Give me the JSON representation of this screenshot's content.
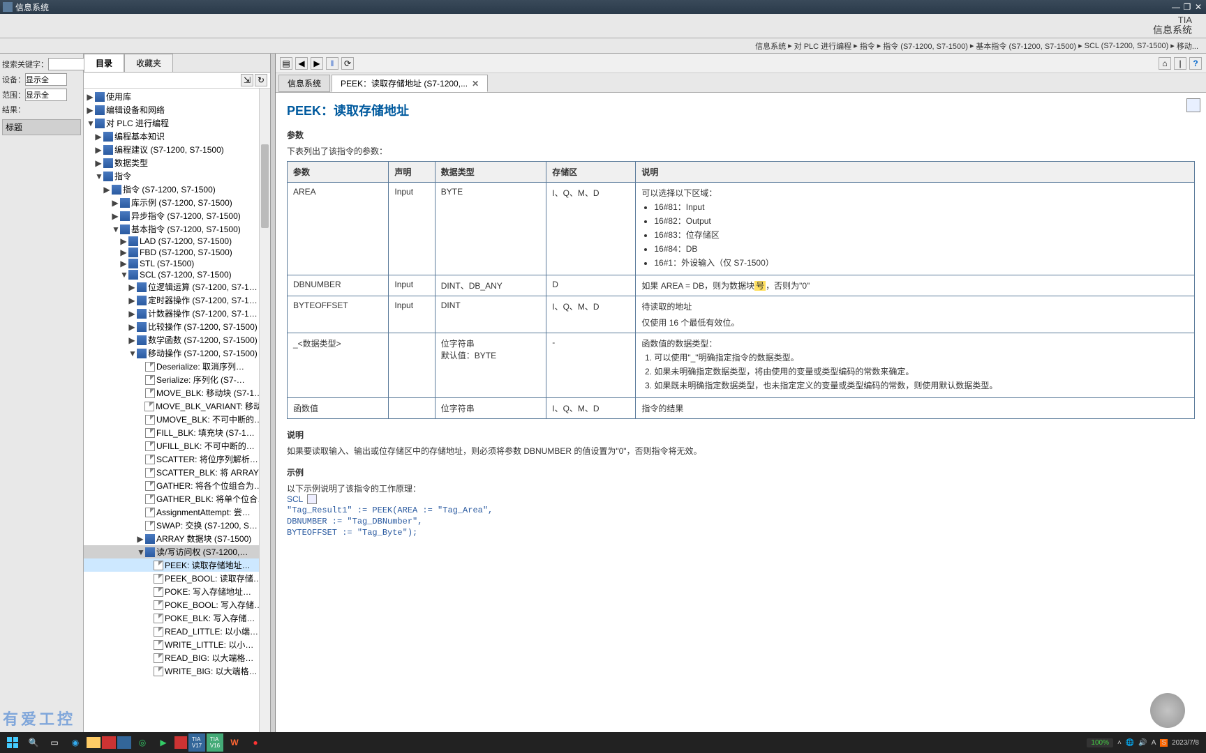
{
  "window": {
    "title": "信息系统"
  },
  "brand": {
    "top": "TIA",
    "bottom": "信息系统"
  },
  "breadcrumb": [
    "信息系统",
    "对 PLC 进行编程",
    "指令",
    "指令 (S7-1200, S7-1500)",
    "基本指令 (S7-1200, S7-1500)",
    "SCL (S7-1200, S7-1500)",
    "移动..."
  ],
  "search": {
    "kw_label": "搜索关键字：",
    "device_label": "设备：",
    "device_value": "显示全",
    "range_label": "范围：",
    "range_value": "显示全",
    "result_label": "结果：",
    "column": "标题"
  },
  "tabs": {
    "toc": "目录",
    "fav": "收藏夹"
  },
  "tree": [
    {
      "ind": 0,
      "exp": "▶",
      "icn": "book",
      "label": "使用库"
    },
    {
      "ind": 0,
      "exp": "▶",
      "icn": "book",
      "label": "编辑设备和网络"
    },
    {
      "ind": 0,
      "exp": "▼",
      "icn": "book",
      "label": "对 PLC 进行编程"
    },
    {
      "ind": 1,
      "exp": "▶",
      "icn": "book",
      "label": "编程基本知识"
    },
    {
      "ind": 1,
      "exp": "▶",
      "icn": "book",
      "label": "编程建议 (S7-1200, S7-1500)"
    },
    {
      "ind": 1,
      "exp": "▶",
      "icn": "book",
      "label": "数据类型"
    },
    {
      "ind": 1,
      "exp": "▼",
      "icn": "book",
      "label": "指令"
    },
    {
      "ind": 2,
      "exp": "▶",
      "icn": "book",
      "label": "指令 (S7-1200, S7-1500)"
    },
    {
      "ind": 3,
      "exp": "▶",
      "icn": "book",
      "label": "库示例 (S7-1200, S7-1500)"
    },
    {
      "ind": 3,
      "exp": "▶",
      "icn": "book",
      "label": "异步指令 (S7-1200, S7-1500)"
    },
    {
      "ind": 3,
      "exp": "▼",
      "icn": "book",
      "label": "基本指令 (S7-1200, S7-1500)"
    },
    {
      "ind": 4,
      "exp": "▶",
      "icn": "book",
      "label": "LAD (S7-1200, S7-1500)"
    },
    {
      "ind": 4,
      "exp": "▶",
      "icn": "book",
      "label": "FBD (S7-1200, S7-1500)"
    },
    {
      "ind": 4,
      "exp": "▶",
      "icn": "book",
      "label": "STL (S7-1500)"
    },
    {
      "ind": 4,
      "exp": "▼",
      "icn": "book",
      "label": "SCL (S7-1200, S7-1500)"
    },
    {
      "ind": 5,
      "exp": "▶",
      "icn": "book",
      "label": "位逻辑运算 (S7-1200, S7-1…"
    },
    {
      "ind": 5,
      "exp": "▶",
      "icn": "book",
      "label": "定时器操作 (S7-1200, S7-1…"
    },
    {
      "ind": 5,
      "exp": "▶",
      "icn": "book",
      "label": "计数器操作 (S7-1200, S7-1…"
    },
    {
      "ind": 5,
      "exp": "▶",
      "icn": "book",
      "label": "比较操作 (S7-1200, S7-1500)"
    },
    {
      "ind": 5,
      "exp": "▶",
      "icn": "book",
      "label": "数学函数 (S7-1200, S7-1500)"
    },
    {
      "ind": 5,
      "exp": "▼",
      "icn": "book",
      "label": "移动操作 (S7-1200, S7-1500)"
    },
    {
      "ind": 6,
      "exp": "",
      "icn": "doc",
      "label": "Deserialize: 取消序列…"
    },
    {
      "ind": 6,
      "exp": "",
      "icn": "doc",
      "label": "Serialize: 序列化 (S7-…"
    },
    {
      "ind": 6,
      "exp": "",
      "icn": "doc",
      "label": "MOVE_BLK: 移动块 (S7-1…"
    },
    {
      "ind": 6,
      "exp": "",
      "icn": "doc",
      "label": "MOVE_BLK_VARIANT: 移动…"
    },
    {
      "ind": 6,
      "exp": "",
      "icn": "doc",
      "label": "UMOVE_BLK: 不可中断的…"
    },
    {
      "ind": 6,
      "exp": "",
      "icn": "doc",
      "label": "FILL_BLK: 填充块 (S7-1…"
    },
    {
      "ind": 6,
      "exp": "",
      "icn": "doc",
      "label": "UFILL_BLK: 不可中断的…"
    },
    {
      "ind": 6,
      "exp": "",
      "icn": "doc",
      "label": "SCATTER: 将位序列解析…"
    },
    {
      "ind": 6,
      "exp": "",
      "icn": "doc",
      "label": "SCATTER_BLK: 将 ARRAY …"
    },
    {
      "ind": 6,
      "exp": "",
      "icn": "doc",
      "label": "GATHER: 将各个位组合为…"
    },
    {
      "ind": 6,
      "exp": "",
      "icn": "doc",
      "label": "GATHER_BLK: 将单个位合…"
    },
    {
      "ind": 6,
      "exp": "",
      "icn": "doc",
      "label": "AssignmentAttempt: 尝…"
    },
    {
      "ind": 6,
      "exp": "",
      "icn": "doc",
      "label": "SWAP: 交换 (S7-1200, S…"
    },
    {
      "ind": 6,
      "exp": "▶",
      "icn": "book",
      "label": "ARRAY 数据块 (S7-1500)"
    },
    {
      "ind": 6,
      "exp": "▼",
      "icn": "book",
      "label": "读/写访问权 (S7-1200,…",
      "sel2": true
    },
    {
      "ind": 7,
      "exp": "",
      "icn": "doc",
      "label": "PEEK: 读取存储地址…",
      "sel": true
    },
    {
      "ind": 7,
      "exp": "",
      "icn": "doc",
      "label": "PEEK_BOOL: 读取存储…"
    },
    {
      "ind": 7,
      "exp": "",
      "icn": "doc",
      "label": "POKE: 写入存储地址…"
    },
    {
      "ind": 7,
      "exp": "",
      "icn": "doc",
      "label": "POKE_BOOL: 写入存储…"
    },
    {
      "ind": 7,
      "exp": "",
      "icn": "doc",
      "label": "POKE_BLK: 写入存储…"
    },
    {
      "ind": 7,
      "exp": "",
      "icn": "doc",
      "label": "READ_LITTLE: 以小端…"
    },
    {
      "ind": 7,
      "exp": "",
      "icn": "doc",
      "label": "WRITE_LITTLE: 以小…"
    },
    {
      "ind": 7,
      "exp": "",
      "icn": "doc",
      "label": "READ_BIG: 以大端格…"
    },
    {
      "ind": 7,
      "exp": "",
      "icn": "doc",
      "label": "WRITE_BIG: 以大端格…"
    }
  ],
  "mtabs": [
    {
      "label": "信息系统",
      "active": false
    },
    {
      "label": "PEEK：读取存储地址 (S7-1200,...",
      "active": true
    }
  ],
  "page": {
    "title": "PEEK：读取存储地址",
    "sec_params": "参数",
    "params_intro": "下表列出了该指令的参数：",
    "th": [
      "参数",
      "声明",
      "数据类型",
      "存储区",
      "说明"
    ],
    "rows": [
      {
        "p": "AREA",
        "d": "Input",
        "t": "BYTE",
        "s": "I、Q、M、D",
        "desc_lead": "可以选择以下区域：",
        "items": [
          "16#81：Input",
          "16#82：Output",
          "16#83：位存储区",
          "16#84：DB",
          "16#1：外设输入（仅 S7-1500）"
        ]
      },
      {
        "p": "DBNUMBER",
        "d": "Input",
        "t": "DINT、DB_ANY",
        "s": "D",
        "desc": "如果 AREA = DB，则为数据块",
        "desc_hl": "号",
        "desc_tail": "，否则为\"0\""
      },
      {
        "p": "BYTEOFFSET",
        "d": "Input",
        "t": "DINT",
        "s": "I、Q、M、D",
        "desc_l1": "待读取的地址",
        "desc_l2": "仅使用 16 个最低有效位。"
      },
      {
        "p": "_<数据类型>",
        "d": "",
        "t_l1": "位字符串",
        "t_l2": "默认值：BYTE",
        "s": "-",
        "desc_lead": "函数值的数据类型：",
        "ol": [
          "可以使用\"_\"明确指定指令的数据类型。",
          "如果未明确指定数据类型，将由使用的变量或类型编码的常数来确定。",
          "如果既未明确指定数据类型，也未指定定义的变量或类型编码的常数，则使用默认数据类型。"
        ]
      },
      {
        "p": "函数值",
        "d": "",
        "t": "位字符串",
        "s": "I、Q、M、D",
        "desc": "指令的结果"
      }
    ],
    "sec_desc": "说明",
    "desc_text": "如果要读取输入、输出或位存储区中的存储地址，则必须将参数 DBNUMBER 的值设置为\"0\"，否则指令将无效。",
    "sec_example": "示例",
    "ex_intro": "以下示例说明了该指令的工作原理：",
    "scl": "SCL",
    "code": [
      "\"Tag_Result1\" := PEEK(AREA := \"Tag_Area\",",
      "DBNUMBER := \"Tag_DBNumber\",",
      "BYTEOFFSET := \"Tag_Byte\");"
    ]
  },
  "taskbar": {
    "zoom": "100%",
    "date": "2023/7/8"
  }
}
